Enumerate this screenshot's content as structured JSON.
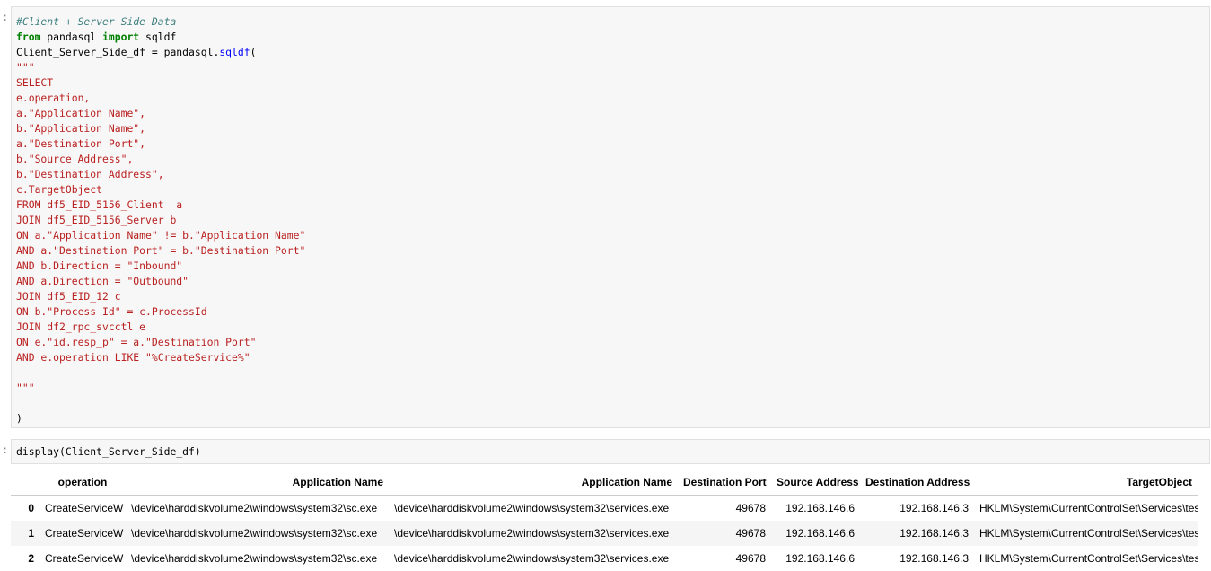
{
  "cells": {
    "prompt_char": ":",
    "cell1": {
      "lines": [
        [
          {
            "c": "cm",
            "t": "#Client + Server Side Data"
          }
        ],
        [
          {
            "c": "kw",
            "t": "from"
          },
          {
            "c": "",
            "t": " pandasql "
          },
          {
            "c": "kw",
            "t": "import"
          },
          {
            "c": "",
            "t": " sqldf"
          }
        ],
        [
          {
            "c": "",
            "t": "Client_Server_Side_df = pandasql."
          },
          {
            "c": "nf",
            "t": "sqldf"
          },
          {
            "c": "",
            "t": "("
          }
        ],
        [
          {
            "c": "st",
            "t": "\"\"\""
          }
        ],
        [
          {
            "c": "st",
            "t": "SELECT"
          }
        ],
        [
          {
            "c": "st",
            "t": "e.operation,"
          }
        ],
        [
          {
            "c": "st",
            "t": "a.\"Application Name\","
          }
        ],
        [
          {
            "c": "st",
            "t": "b.\"Application Name\","
          }
        ],
        [
          {
            "c": "st",
            "t": "a.\"Destination Port\","
          }
        ],
        [
          {
            "c": "st",
            "t": "b.\"Source Address\","
          }
        ],
        [
          {
            "c": "st",
            "t": "b.\"Destination Address\","
          }
        ],
        [
          {
            "c": "st",
            "t": "c.TargetObject"
          }
        ],
        [
          {
            "c": "st",
            "t": "FROM df5_EID_5156_Client  a"
          }
        ],
        [
          {
            "c": "st",
            "t": "JOIN df5_EID_5156_Server b"
          }
        ],
        [
          {
            "c": "st",
            "t": "ON a.\"Application Name\" != b.\"Application Name\""
          }
        ],
        [
          {
            "c": "st",
            "t": "AND a.\"Destination Port\" = b.\"Destination Port\""
          }
        ],
        [
          {
            "c": "st",
            "t": "AND b.Direction = \"Inbound\""
          }
        ],
        [
          {
            "c": "st",
            "t": "AND a.Direction = \"Outbound\""
          }
        ],
        [
          {
            "c": "st",
            "t": "JOIN df5_EID_12 c"
          }
        ],
        [
          {
            "c": "st",
            "t": "ON b.\"Process Id\" = c.ProcessId"
          }
        ],
        [
          {
            "c": "st",
            "t": "JOIN df2_rpc_svcctl e"
          }
        ],
        [
          {
            "c": "st",
            "t": "ON e.\"id.resp_p\" = a.\"Destination Port\""
          }
        ],
        [
          {
            "c": "st",
            "t": "AND e.operation LIKE \"%CreateService%\""
          }
        ],
        [
          {
            "c": "st",
            "t": ""
          }
        ],
        [
          {
            "c": "st",
            "t": "\"\"\""
          }
        ],
        [
          {
            "c": "",
            "t": ""
          }
        ],
        [
          {
            "c": "",
            "t": ")"
          }
        ]
      ]
    },
    "cell2": {
      "lines": [
        [
          {
            "c": "",
            "t": "display(Client_Server_Side_df)"
          }
        ]
      ]
    }
  },
  "table": {
    "columns": [
      "operation",
      "Application Name",
      "Application Name",
      "Destination Port",
      "Source Address",
      "Destination Address",
      "TargetObject"
    ],
    "rows": [
      {
        "index": "0",
        "cells": [
          "CreateServiceW",
          "\\device\\harddiskvolume2\\windows\\system32\\sc.exe",
          "\\device\\harddiskvolume2\\windows\\system32\\services.exe",
          "49678",
          "192.168.146.6",
          "192.168.146.3",
          "HKLM\\System\\CurrentControlSet\\Services\\test"
        ]
      },
      {
        "index": "1",
        "cells": [
          "CreateServiceW",
          "\\device\\harddiskvolume2\\windows\\system32\\sc.exe",
          "\\device\\harddiskvolume2\\windows\\system32\\services.exe",
          "49678",
          "192.168.146.6",
          "192.168.146.3",
          "HKLM\\System\\CurrentControlSet\\Services\\test"
        ]
      },
      {
        "index": "2",
        "cells": [
          "CreateServiceW",
          "\\device\\harddiskvolume2\\windows\\system32\\sc.exe",
          "\\device\\harddiskvolume2\\windows\\system32\\services.exe",
          "49678",
          "192.168.146.6",
          "192.168.146.3",
          "HKLM\\System\\CurrentControlSet\\Services\\test"
        ]
      }
    ]
  }
}
